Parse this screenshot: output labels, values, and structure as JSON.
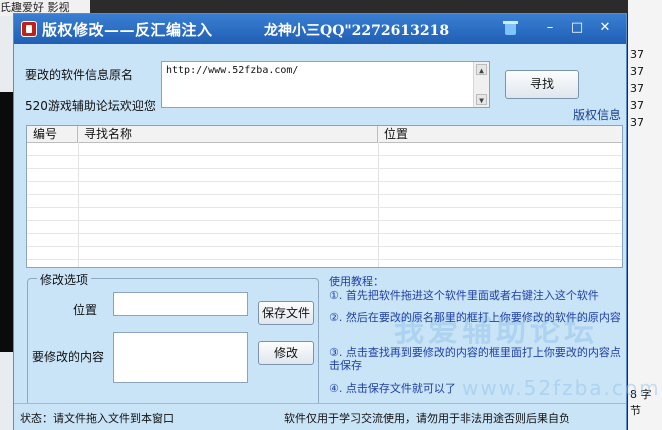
{
  "background": {
    "left_text": "氏趣爱好 影视",
    "right_items": [
      "37",
      "37",
      "37",
      "37",
      "37"
    ],
    "right_bottom": "8 字节"
  },
  "window": {
    "title": "版权修改——反汇编注入",
    "title_qq": "龙神小三QQ\"2272613218",
    "minimize": "–",
    "maximize": "□",
    "close": "✕"
  },
  "form": {
    "original_name_label": "要改的软件信息原名",
    "welcome_text": "520游戏辅助论坛欢迎您",
    "original_name_value": "http://www.52fzba.com/",
    "search_button": "寻找",
    "copyright_link": "版权信息"
  },
  "table": {
    "columns": [
      "编号",
      "寻找名称",
      "位置"
    ],
    "rows": []
  },
  "options": {
    "group_title": "修改选项",
    "position_label": "位置",
    "content_label": "要修改的内容",
    "position_value": "",
    "content_value": "",
    "save_button": "保存文件",
    "modify_button": "修改"
  },
  "tutorial": {
    "title": "使用教程：",
    "steps": [
      "①. 首先把软件拖进这个软件里面或者右键注入这个软件",
      "②. 然后在要改的原名那里的框打上你要修改的软件的原内容",
      "③. 点击查找再到要修改的内容的框里面打上你要改的内容点击保存",
      "④. 点击保存文件就可以了"
    ]
  },
  "watermark": {
    "text": "我爱辅助论坛",
    "url": "www.52fzba.com"
  },
  "status": {
    "left": "状态：请文件拖入文件到本窗口",
    "right": "软件仅用于学习交流使用，请勿用于非法用途否则后果自负"
  }
}
